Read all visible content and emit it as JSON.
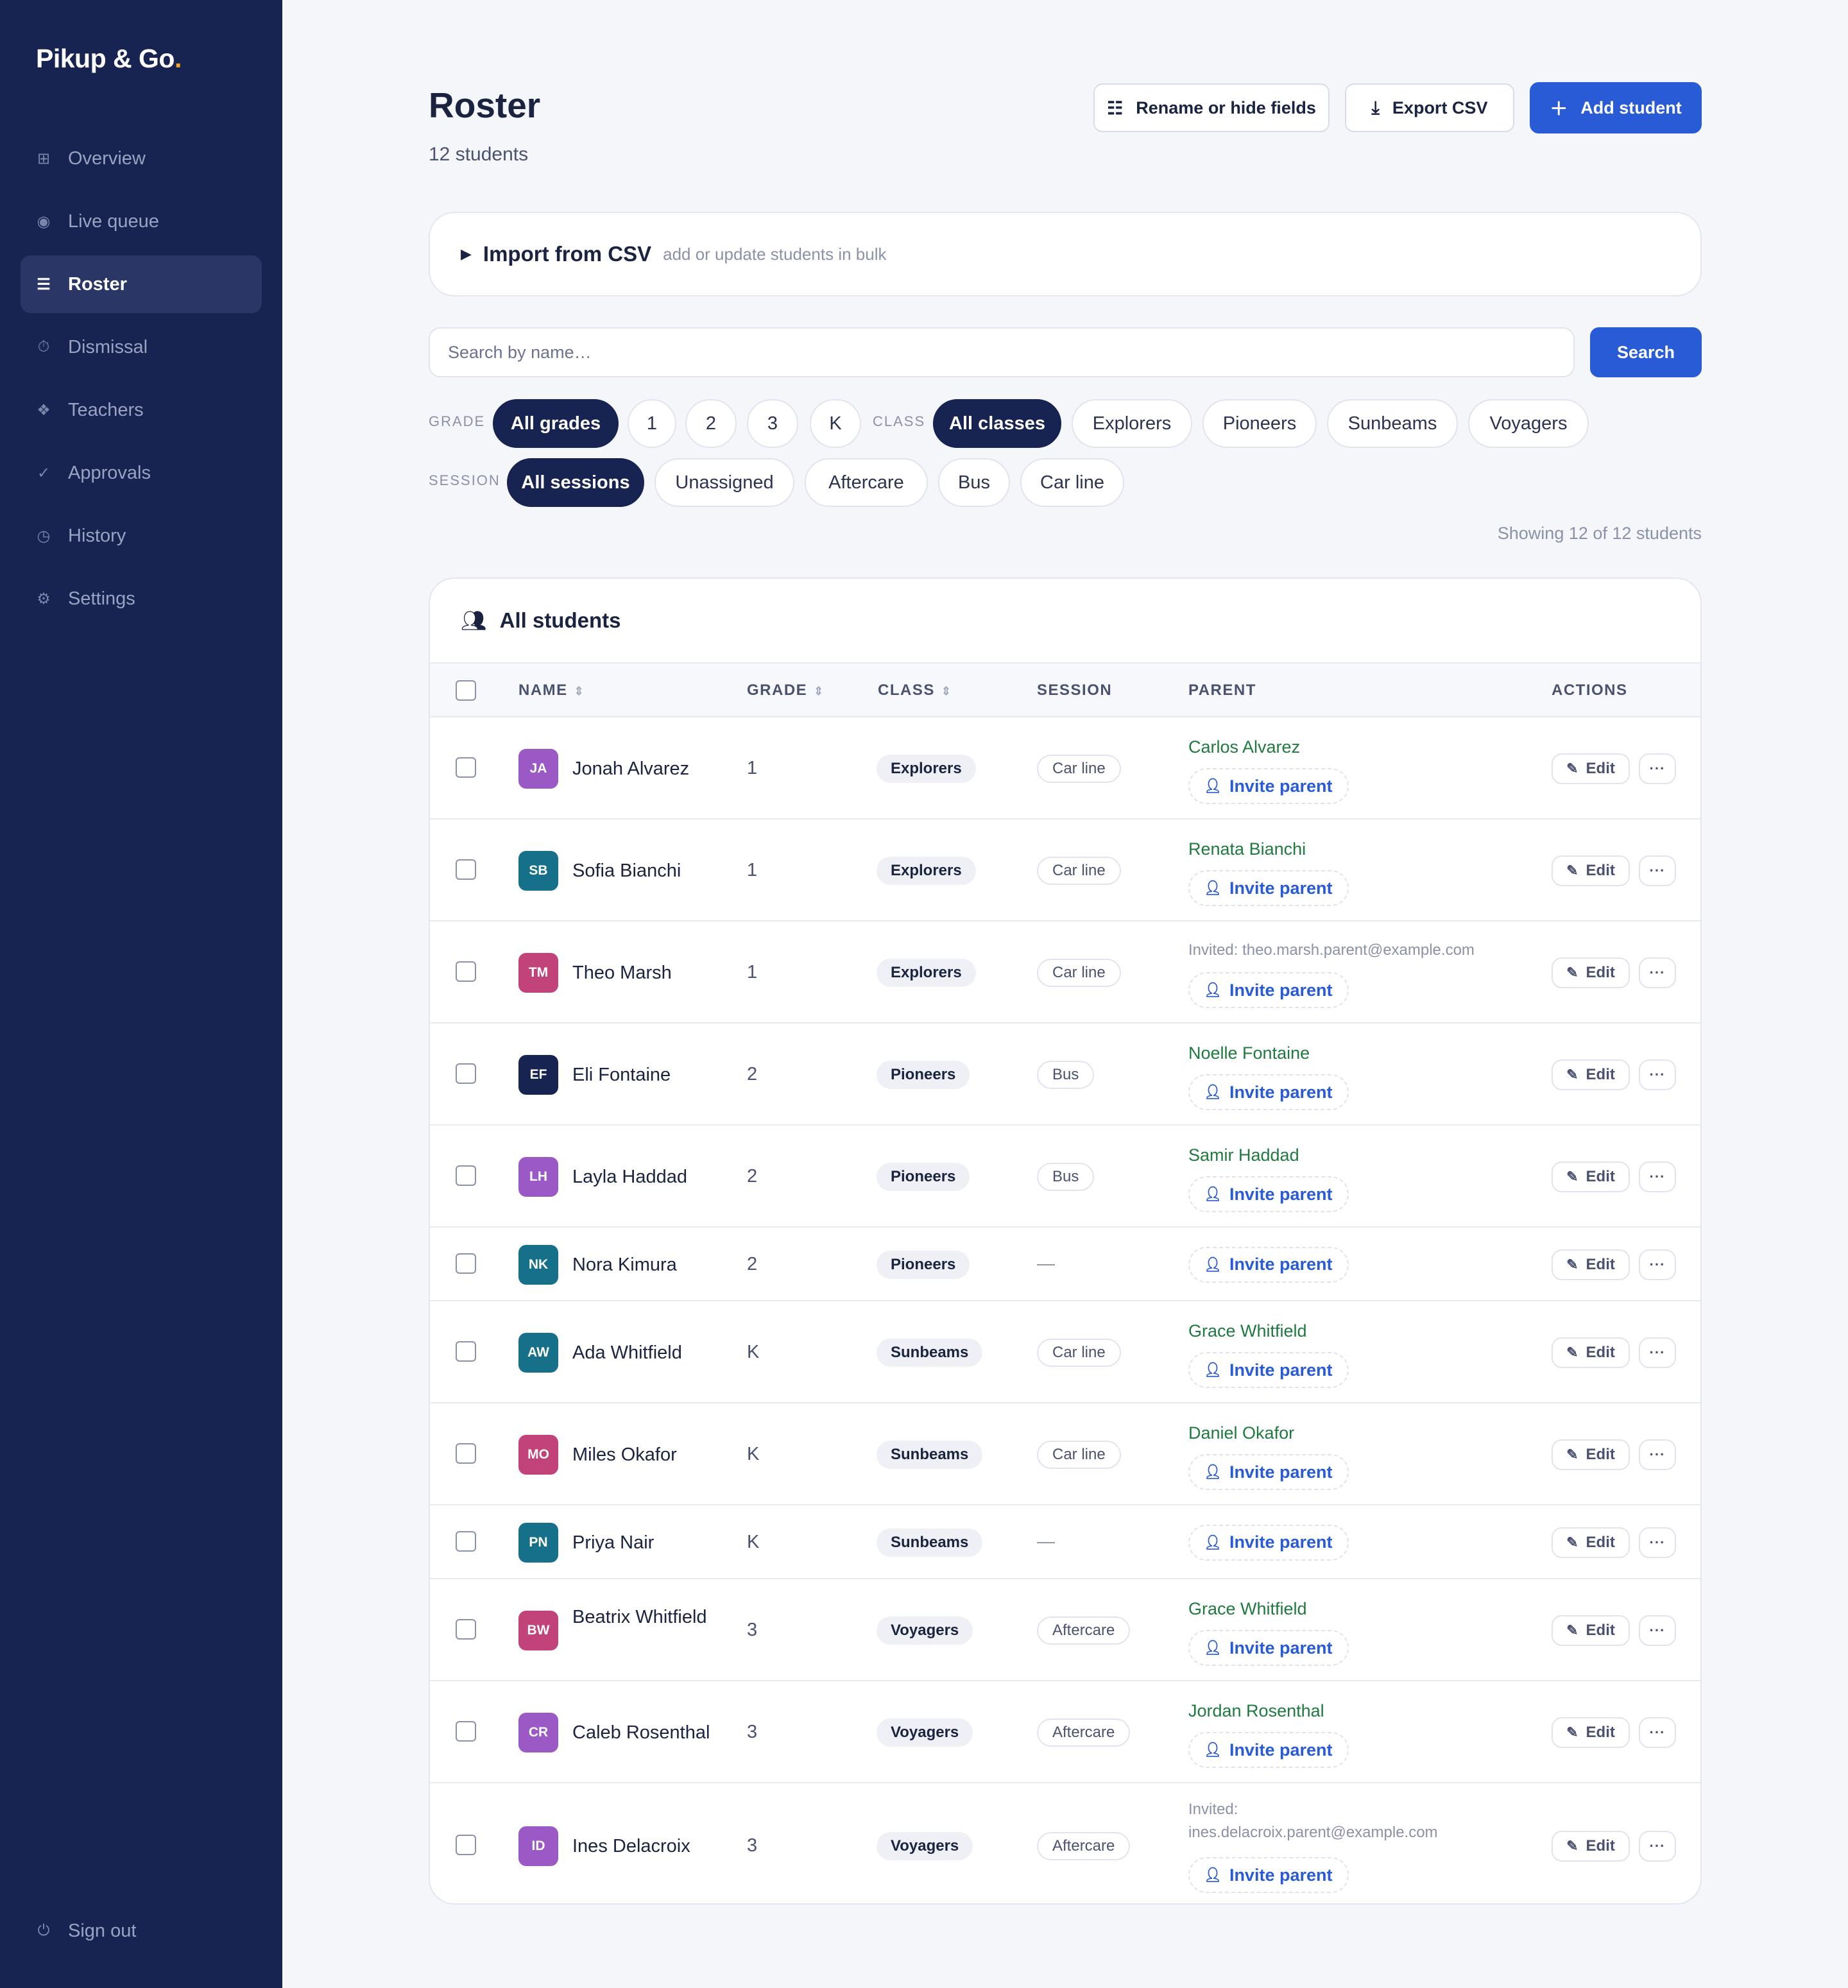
{
  "brand": {
    "name": "Pikup & Go",
    "dot": "."
  },
  "nav": {
    "items": [
      {
        "label": "Overview",
        "icon": "grid-icon"
      },
      {
        "label": "Live queue",
        "icon": "radio-icon"
      },
      {
        "label": "Roster",
        "icon": "list-icon",
        "active": true
      },
      {
        "label": "Dismissal",
        "icon": "timer-icon"
      },
      {
        "label": "Teachers",
        "icon": "diamond-icon"
      },
      {
        "label": "Approvals",
        "icon": "check-icon"
      },
      {
        "label": "History",
        "icon": "clock-icon"
      },
      {
        "label": "Settings",
        "icon": "gear-icon"
      }
    ],
    "signout": "Sign out"
  },
  "header": {
    "title": "Roster",
    "subtitle": "12 students",
    "rename_label": "Rename or hide fields",
    "export_label": "Export CSV",
    "add_label": "Add student"
  },
  "import": {
    "title": "Import from CSV",
    "subtitle": "add or update students in bulk"
  },
  "search": {
    "placeholder": "Search by name…",
    "value": "",
    "button": "Search"
  },
  "filters": {
    "grade_label": "GRADE",
    "grades": [
      "All grades",
      "1",
      "2",
      "3",
      "K"
    ],
    "class_label": "CLASS",
    "classes": [
      "All classes",
      "Explorers",
      "Pioneers",
      "Sunbeams",
      "Voyagers"
    ],
    "session_label": "SESSION",
    "sessions": [
      "All sessions",
      "Unassigned",
      "Aftercare",
      "Bus",
      "Car line"
    ]
  },
  "showing": "Showing 12 of 12 students",
  "table": {
    "title": "All students",
    "columns": {
      "name": "NAME",
      "grade": "GRADE",
      "class": "CLASS",
      "session": "SESSION",
      "parent": "PARENT",
      "actions": "ACTIONS"
    },
    "invite_label": "Invite parent",
    "edit_label": "Edit",
    "more_label": "···",
    "empty_session": "—",
    "rows": [
      {
        "initials": "JA",
        "color": "#9b59c6",
        "name": "Jonah Alvarez",
        "grade": "1",
        "class": "Explorers",
        "session": "Car line",
        "parent": "Carlos Alvarez",
        "invited": ""
      },
      {
        "initials": "SB",
        "color": "#16708a",
        "name": "Sofia Bianchi",
        "grade": "1",
        "class": "Explorers",
        "session": "Car line",
        "parent": "Renata Bianchi",
        "invited": ""
      },
      {
        "initials": "TM",
        "color": "#c2427a",
        "name": "Theo Marsh",
        "grade": "1",
        "class": "Explorers",
        "session": "Car line",
        "parent": "",
        "invited": "Invited: theo.marsh.parent@example.com"
      },
      {
        "initials": "EF",
        "color": "#172350",
        "name": "Eli Fontaine",
        "grade": "2",
        "class": "Pioneers",
        "session": "Bus",
        "parent": "Noelle Fontaine",
        "invited": ""
      },
      {
        "initials": "LH",
        "color": "#9b59c6",
        "name": "Layla Haddad",
        "grade": "2",
        "class": "Pioneers",
        "session": "Bus",
        "parent": "Samir Haddad",
        "invited": ""
      },
      {
        "initials": "NK",
        "color": "#16708a",
        "name": "Nora Kimura",
        "grade": "2",
        "class": "Pioneers",
        "session": "",
        "parent": "",
        "invited": ""
      },
      {
        "initials": "AW",
        "color": "#16708a",
        "name": "Ada Whitfield",
        "grade": "K",
        "class": "Sunbeams",
        "session": "Car line",
        "parent": "Grace Whitfield",
        "invited": ""
      },
      {
        "initials": "MO",
        "color": "#c2427a",
        "name": "Miles Okafor",
        "grade": "K",
        "class": "Sunbeams",
        "session": "Car line",
        "parent": "Daniel Okafor",
        "invited": ""
      },
      {
        "initials": "PN",
        "color": "#16708a",
        "name": "Priya Nair",
        "grade": "K",
        "class": "Sunbeams",
        "session": "",
        "parent": "",
        "invited": ""
      },
      {
        "initials": "BW",
        "color": "#c2427a",
        "name": "Beatrix Whitfield",
        "grade": "3",
        "class": "Voyagers",
        "session": "Aftercare",
        "parent": "Grace Whitfield",
        "invited": ""
      },
      {
        "initials": "CR",
        "color": "#9b59c6",
        "name": "Caleb Rosenthal",
        "grade": "3",
        "class": "Voyagers",
        "session": "Aftercare",
        "parent": "Jordan Rosenthal",
        "invited": ""
      },
      {
        "initials": "ID",
        "color": "#9b59c6",
        "name": "Ines Delacroix",
        "grade": "3",
        "class": "Voyagers",
        "session": "Aftercare",
        "parent": "",
        "invited": "Invited: ines.delacroix.parent@example.com"
      }
    ]
  }
}
